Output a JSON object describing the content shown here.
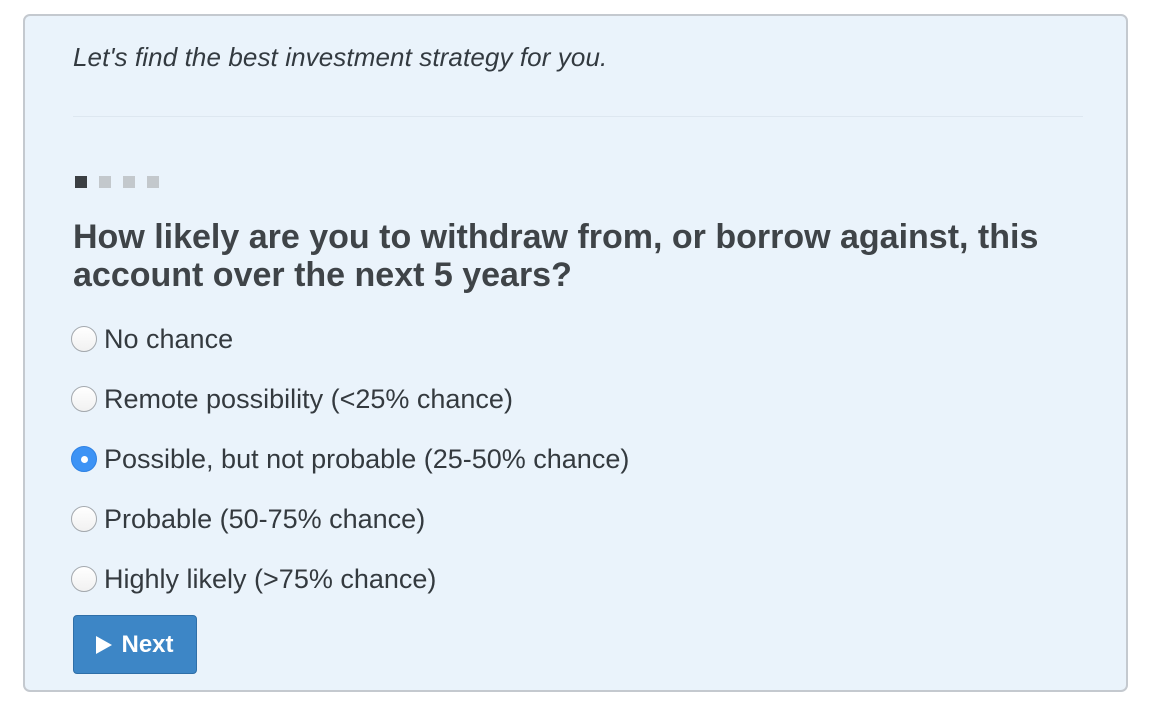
{
  "intro": "Let's find the best investment strategy for you.",
  "progress": {
    "current_step": 1,
    "total_steps": 4
  },
  "question": "How likely are you to withdraw from, or borrow against, this account over the next 5 years?",
  "options": [
    {
      "label": "No chance",
      "selected": false
    },
    {
      "label": "Remote possibility (<25% chance)",
      "selected": false
    },
    {
      "label": "Possible, but not probable (25-50% chance)",
      "selected": true
    },
    {
      "label": "Probable (50-75% chance)",
      "selected": false
    },
    {
      "label": "Highly likely (>75% chance)",
      "selected": false
    }
  ],
  "next_button": {
    "label": "Next",
    "icon": "play-icon"
  },
  "colors": {
    "panel_background": "#eaf3fb",
    "button": "#3d86c6",
    "radio_selected": "#3d93f5",
    "step_active": "#3b3f43",
    "step_inactive": "#c3c8cc"
  }
}
